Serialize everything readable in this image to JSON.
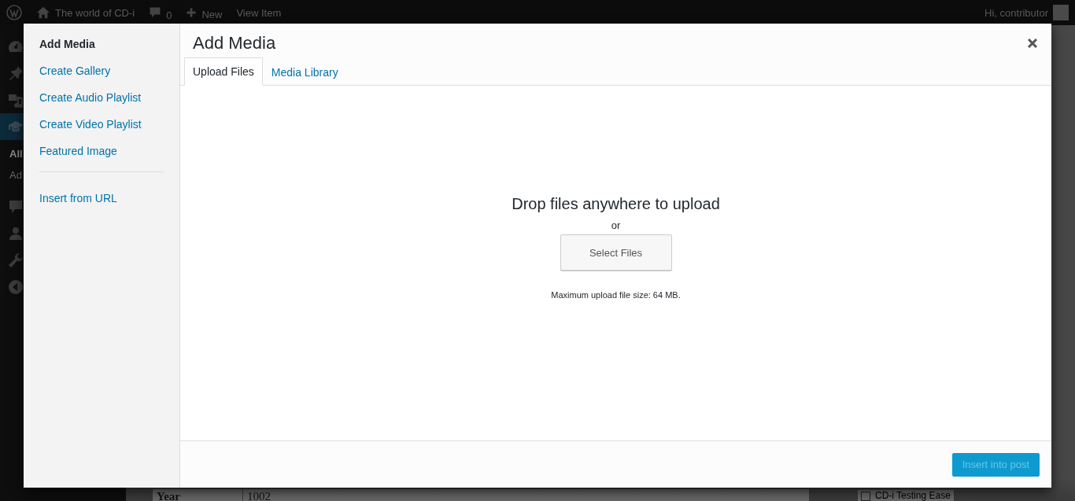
{
  "admin_bar": {
    "site_name": "The world of CD-i",
    "comments_count": "0",
    "new_label": "New",
    "view_label": "View Item",
    "greeting": "Hi, contributor"
  },
  "admin_menu": {
    "items": [
      {
        "selected": false
      },
      {
        "selected": false
      },
      {
        "selected": false
      },
      {
        "selected": true
      },
      {
        "selected": false
      },
      {
        "selected": false
      },
      {
        "selected": false
      },
      {
        "selected": false
      }
    ],
    "submenu": [
      {
        "label": "All",
        "selected": true
      },
      {
        "label": "Ad",
        "selected": false
      }
    ]
  },
  "post_fields": [
    {
      "label": "Year",
      "value": "1002"
    }
  ],
  "side_checkbox": {
    "label": "CD-i Testing Ease",
    "checked": false
  },
  "modal": {
    "menu": [
      {
        "label": "Add Media",
        "selected": true,
        "separator_before": false
      },
      {
        "label": "Create Gallery",
        "selected": false,
        "separator_before": false
      },
      {
        "label": "Create Audio Playlist",
        "selected": false,
        "separator_before": false
      },
      {
        "label": "Create Video Playlist",
        "selected": false,
        "separator_before": false
      },
      {
        "label": "Featured Image",
        "selected": false,
        "separator_before": false
      },
      {
        "label": "Insert from URL",
        "selected": false,
        "separator_before": true
      }
    ],
    "title": "Add Media",
    "tabs": [
      {
        "label": "Upload Files",
        "selected": true
      },
      {
        "label": "Media Library",
        "selected": false
      }
    ],
    "uploader": {
      "heading": "Drop files anywhere to upload",
      "or": "or",
      "button": "Select Files",
      "max_size": "Maximum upload file size: 64 MB."
    },
    "footer": {
      "primary_button": "Insert into post",
      "disabled": true
    }
  }
}
